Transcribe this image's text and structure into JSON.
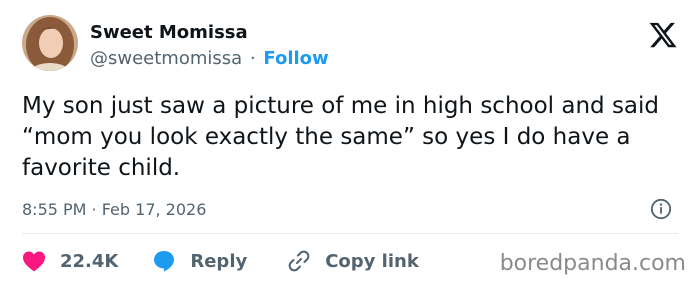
{
  "author": {
    "display_name": "Sweet Momissa",
    "handle": "@sweetmomissa",
    "separator": "·",
    "follow_label": "Follow"
  },
  "tweet": {
    "text": "My son just saw a picture of me in high school and said “mom you look exactly the same” so yes I do have a favorite child.",
    "timestamp": "8:55 PM · Feb 17, 2026"
  },
  "actions": {
    "like_count": "22.4K",
    "reply_label": "Reply",
    "copy_link_label": "Copy link"
  },
  "watermark": "boredpanda.com",
  "icons": {
    "brand": "x-logo-icon",
    "info": "info-icon",
    "like": "heart-icon",
    "reply": "speech-bubble-icon",
    "copy": "link-icon"
  },
  "colors": {
    "like": "#f91880",
    "reply": "#1d9bf0",
    "follow": "#1d9bf0",
    "muted": "#536471",
    "text": "#0f1419"
  }
}
